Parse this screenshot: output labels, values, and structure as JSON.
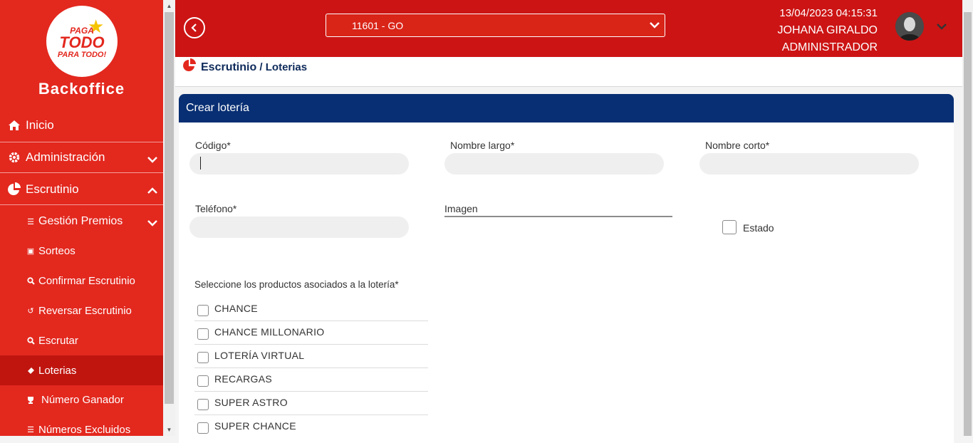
{
  "sidebar": {
    "logo": {
      "line1": "PAGA",
      "line2": "TODO",
      "line3": "PARA TODO!"
    },
    "brand": "Backoffice",
    "items": [
      {
        "label": "Inicio",
        "icon": "home-icon"
      },
      {
        "label": "Administración",
        "icon": "gear-icon"
      },
      {
        "label": "Escrutinio",
        "icon": "pie-chart-icon"
      }
    ],
    "subitems": [
      {
        "label": "Gestión Premios",
        "icon": "sliders-icon"
      },
      {
        "label": "Sorteos",
        "icon": "calendar-icon"
      },
      {
        "label": "Confirmar Escrutinio",
        "icon": "search-icon"
      },
      {
        "label": "Reversar Escrutinio",
        "icon": "undo-icon"
      },
      {
        "label": "Escrutar",
        "icon": "search-icon"
      },
      {
        "label": "Loterias",
        "icon": "ticket-icon"
      },
      {
        "label": "Número Ganador",
        "icon": "trophy-icon"
      },
      {
        "label": "Números Excluidos",
        "icon": "list-icon"
      }
    ]
  },
  "header": {
    "branch_select": "11601 - GO",
    "datetime": "13/04/2023 04:15:31",
    "user_name": "JOHANA GIRALDO",
    "user_role": "ADMINISTRADOR"
  },
  "breadcrumb": {
    "section": "Escrutinio",
    "separator": " / ",
    "page": "Loterias"
  },
  "form": {
    "title": "Crear lotería",
    "codigo_label": "Código*",
    "codigo_value": "",
    "nombre_largo_label": "Nombre largo*",
    "nombre_corto_label": "Nombre corto*",
    "telefono_label": "Teléfono*",
    "imagen_label": "Imagen",
    "estado_label": "Estado",
    "products_label": "Seleccione los productos asociados a la lotería*",
    "products": [
      "CHANCE",
      "CHANCE MILLONARIO",
      "LOTERÍA VIRTUAL",
      "RECARGAS",
      "SUPER ASTRO",
      "SUPER CHANCE"
    ]
  },
  "colors": {
    "sidebar": "#e3281e",
    "header": "#cc1414",
    "card_header": "#082f73",
    "active_item": "#c0150f"
  }
}
